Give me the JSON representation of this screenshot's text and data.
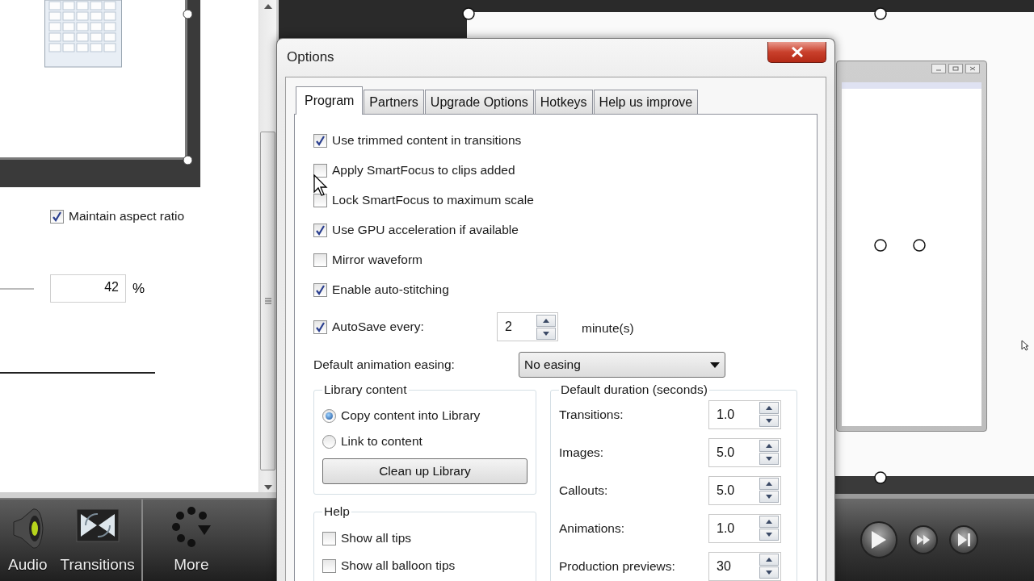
{
  "editor": {
    "aspect": {
      "label": "Maintain aspect ratio",
      "checked": true
    },
    "scale": {
      "value": "42",
      "unit": "%"
    }
  },
  "toolbar": [
    {
      "label": "Audio"
    },
    {
      "label": "Transitions"
    },
    {
      "label": "More"
    }
  ],
  "dialog": {
    "title": "Options",
    "tabs": [
      {
        "label": "Program",
        "selected": true
      },
      {
        "label": "Partners",
        "selected": false
      },
      {
        "label": "Upgrade Options",
        "selected": false
      },
      {
        "label": "Hotkeys",
        "selected": false
      },
      {
        "label": "Help us improve",
        "selected": false
      }
    ],
    "options": [
      {
        "label": "Use trimmed content in transitions",
        "checked": true
      },
      {
        "label": "Apply SmartFocus to clips added",
        "checked": false
      },
      {
        "label": "Lock SmartFocus to maximum scale",
        "checked": false
      },
      {
        "label": "Use GPU acceleration if available",
        "checked": true
      },
      {
        "label": "Mirror waveform",
        "checked": false
      },
      {
        "label": "Enable auto-stitching",
        "checked": true
      }
    ],
    "autosave": {
      "label": "AutoSave every:",
      "checked": true,
      "value": "2",
      "unit": "minute(s)"
    },
    "easing": {
      "label": "Default animation easing:",
      "value": "No easing"
    },
    "library": {
      "title": "Library content",
      "choices": [
        {
          "label": "Copy content into Library",
          "selected": true
        },
        {
          "label": "Link to content",
          "selected": false
        }
      ],
      "button": "Clean up Library"
    },
    "help": {
      "title": "Help",
      "options": [
        {
          "label": "Show all tips",
          "checked": false
        },
        {
          "label": "Show all balloon tips",
          "checked": false
        }
      ]
    },
    "durations": {
      "title": "Default duration (seconds)",
      "rows": [
        {
          "label": "Transitions:",
          "value": "1.0"
        },
        {
          "label": "Images:",
          "value": "5.0"
        },
        {
          "label": "Callouts:",
          "value": "5.0"
        },
        {
          "label": "Animations:",
          "value": "1.0"
        },
        {
          "label": "Production previews:",
          "value": "30"
        }
      ]
    }
  }
}
